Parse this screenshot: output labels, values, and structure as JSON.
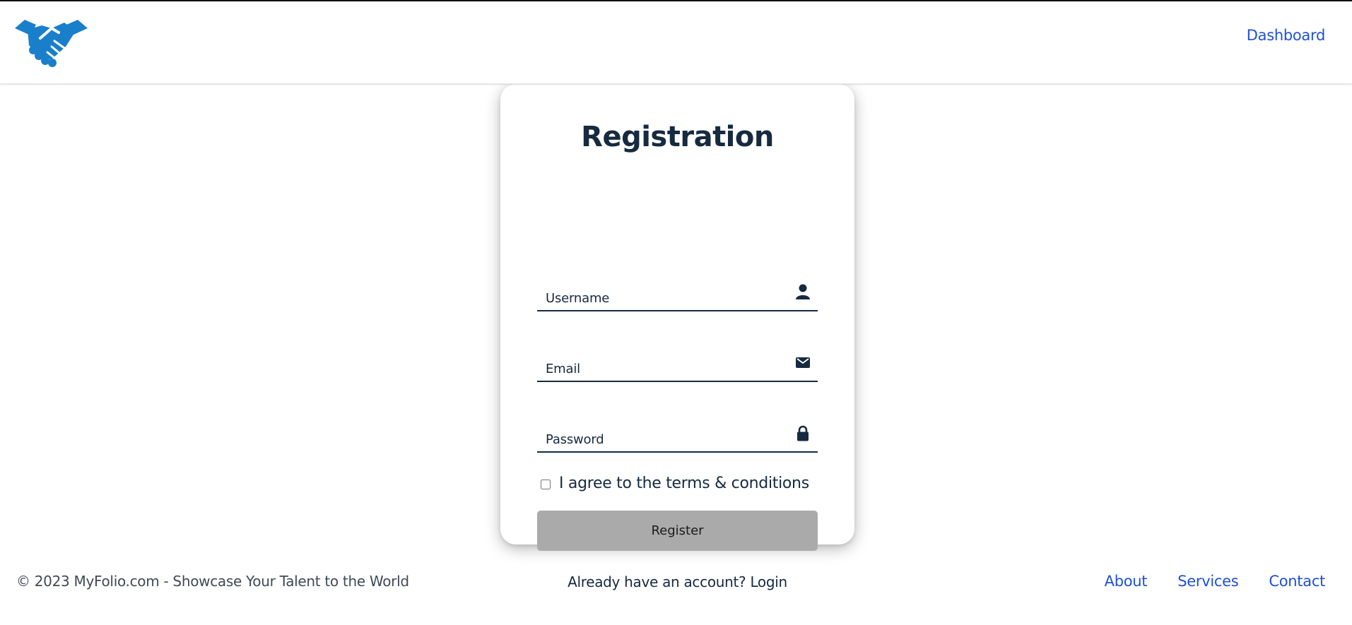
{
  "header": {
    "logo_icon": "handshake-icon",
    "nav": {
      "dashboard_label": "Dashboard"
    }
  },
  "form": {
    "title": "Registration",
    "fields": {
      "username": {
        "placeholder": "Username",
        "value": "",
        "icon": "user-icon"
      },
      "email": {
        "placeholder": "Email",
        "value": "",
        "icon": "envelope-icon"
      },
      "password": {
        "placeholder": "Password",
        "value": "",
        "icon": "lock-icon"
      }
    },
    "terms": {
      "label": "I agree to the terms & conditions",
      "checked": false
    },
    "submit_label": "Register",
    "login_prompt": "Already have an account?",
    "login_link": "Login"
  },
  "footer": {
    "copyright": "© 2023 MyFolio.com - Showcase Your Talent to the World",
    "links": {
      "about": "About",
      "services": "Services",
      "contact": "Contact"
    }
  },
  "colors": {
    "brand_blue": "#1a7fcb",
    "link_blue": "#1f51d8",
    "text_dark": "#162a40",
    "button_gray": "#aaaaaa"
  }
}
